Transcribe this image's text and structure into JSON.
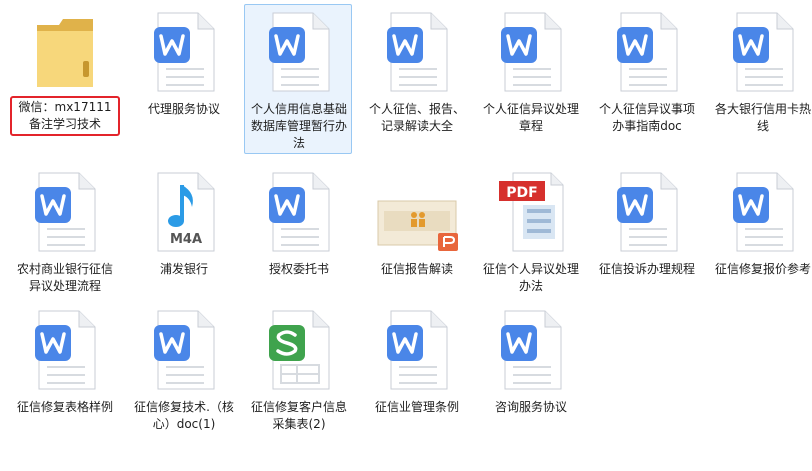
{
  "files": [
    {
      "id": "folder-wechat",
      "type": "folder",
      "label": "微信：mx17111 备注学习技术",
      "highlight": true
    },
    {
      "id": "daili",
      "type": "wps",
      "label": "代理服务协议"
    },
    {
      "id": "geren-xinyong",
      "type": "wps",
      "label": "个人信用信息基础数据库管理暂行办法",
      "selected": true
    },
    {
      "id": "geren-zhengxin-baogao",
      "type": "wps",
      "label": "个人征信、报告、记录解读大全"
    },
    {
      "id": "geren-yiyi-zhangcheng",
      "type": "wps",
      "label": "个人征信异议处理章程"
    },
    {
      "id": "geren-yiyi-zhinan",
      "type": "wps",
      "label": "个人征信异议事项办事指南doc"
    },
    {
      "id": "yinhang-rexian",
      "type": "wps",
      "label": "各大银行信用卡热线"
    },
    {
      "id": "nongcun",
      "type": "wps",
      "label": "农村商业银行征信异议处理流程"
    },
    {
      "id": "pufa",
      "type": "m4a",
      "label": "浦发银行",
      "badge": "M4A"
    },
    {
      "id": "shouquan",
      "type": "wps",
      "label": "授权委托书"
    },
    {
      "id": "baogao-jiedu",
      "type": "ppt",
      "label": "征信报告解读"
    },
    {
      "id": "geren-yiyi-banfa",
      "type": "pdf",
      "label": "征信个人异议处理办法",
      "badge": "PDF"
    },
    {
      "id": "tousu",
      "type": "wps",
      "label": "征信投诉办理规程"
    },
    {
      "id": "xiufu-baojia",
      "type": "wps",
      "label": "征信修复报价参考"
    },
    {
      "id": "xiufu-biaoge",
      "type": "wps",
      "label": "征信修复表格样例"
    },
    {
      "id": "xiufu-jishu",
      "type": "wps",
      "label": "征信修复技术.（核心）doc(1)"
    },
    {
      "id": "kehu-xinxi",
      "type": "et",
      "label": "征信修复客户信息采集表(2)"
    },
    {
      "id": "guanli-tiaoli",
      "type": "wps",
      "label": "征信业管理条例"
    },
    {
      "id": "zixun",
      "type": "wps",
      "label": "咨询服务协议"
    }
  ],
  "colors": {
    "wps_blue": "#4a86e8",
    "et_green": "#3fa34d",
    "pdf_red": "#d6302d",
    "ppt_orange": "#e8663c",
    "folder_yellow": "#f5cf6c",
    "music_blue": "#2b9be6",
    "highlight_red": "#e3242b"
  }
}
